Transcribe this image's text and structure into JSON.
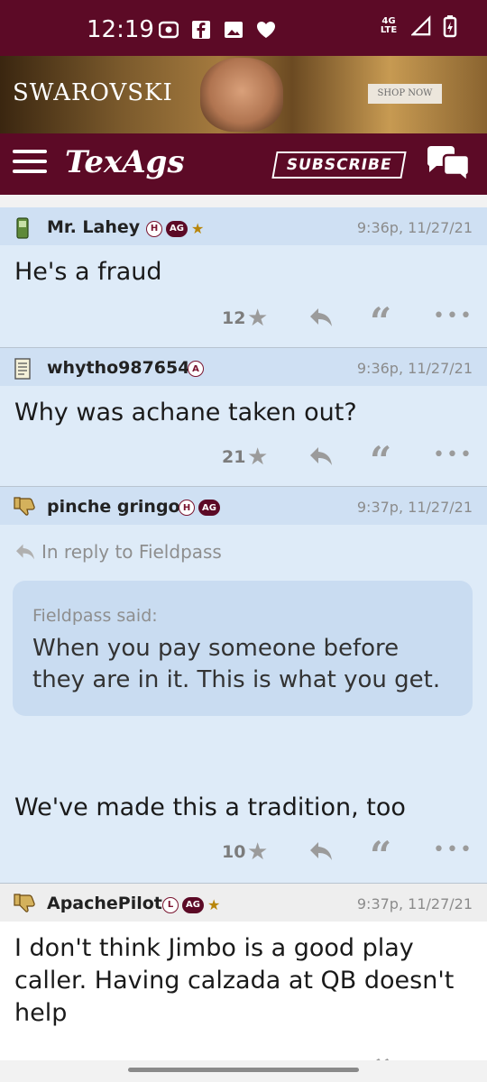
{
  "status_bar": {
    "time": "12:19",
    "network": "4G LTE"
  },
  "ad": {
    "brand": "SWAROVSKI",
    "cta": "SHOP NOW"
  },
  "nav": {
    "logo": "TexAgs",
    "subscribe": "SUBSCRIBE"
  },
  "posts": [
    {
      "username": "Mr. Lahey",
      "badges": [
        "H",
        "AG",
        "★"
      ],
      "time": "9:36p, 11/27/21",
      "body": "He's a fraud",
      "stars": "12"
    },
    {
      "username": "whytho987654",
      "badges": [
        "A"
      ],
      "time": "9:36p, 11/27/21",
      "body": "Why was achane taken out?",
      "stars": "21"
    },
    {
      "username": "pinche gringo",
      "badges": [
        "H",
        "AG"
      ],
      "time": "9:37p, 11/27/21",
      "reply_to": "In reply to Fieldpass",
      "quote_author": "Fieldpass said:",
      "quote_text": "When you pay someone before they are in it. This is what you get.",
      "body": "We've made this a tradition, too",
      "stars": "10"
    },
    {
      "username": "ApachePilot",
      "badges": [
        "L",
        "AG",
        "★"
      ],
      "time": "9:37p, 11/27/21",
      "body": "I don't think Jimbo is a good play caller. Having calzada at QB doesn't help",
      "stars": ""
    }
  ],
  "colors": {
    "maroon": "#5c0a26",
    "post_bg": "#deebf8",
    "post_header": "#cfe0f3",
    "quote_bg": "#c9dcf1",
    "star_gold": "#b8860b"
  }
}
